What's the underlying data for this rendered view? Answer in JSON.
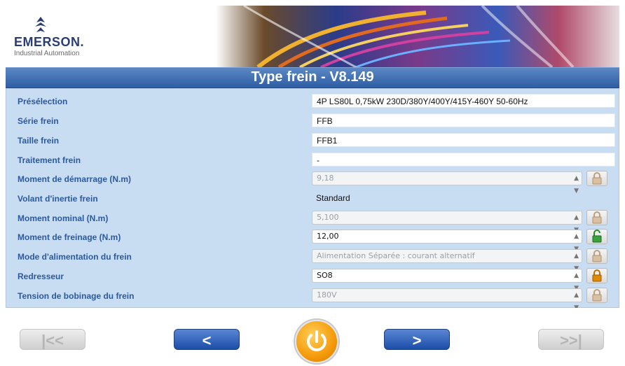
{
  "app": {
    "brand_name": "EMERSON.",
    "brand_sub": "Industrial Automation",
    "title": "Type frein - V8.149"
  },
  "rows": [
    {
      "label": "Présélection",
      "value": "4P LS80L 0,75kW 230D/380Y/400Y/415Y-460Y 50-60Hz",
      "kind": "text"
    },
    {
      "label": "Série frein",
      "value": "FFB",
      "kind": "text"
    },
    {
      "label": "Taille frein",
      "value": "FFB1",
      "kind": "text"
    },
    {
      "label": "Traitement frein",
      "value": "-",
      "kind": "text"
    },
    {
      "label": "Moment de démarrage (N.m)",
      "value": "9,18",
      "kind": "select",
      "state": "disabled",
      "lock": "locked-grey"
    },
    {
      "label": "Volant d'inertie frein",
      "value": "Standard",
      "kind": "plain"
    },
    {
      "label": "Moment nominal (N.m)",
      "value": "5,100",
      "kind": "select",
      "state": "disabled",
      "lock": "locked-grey"
    },
    {
      "label": "Moment de freinage (N.m)",
      "value": "12,00",
      "kind": "select",
      "state": "active",
      "lock": "unlocked-green"
    },
    {
      "label": "Mode d'alimentation du frein",
      "value": "Alimentation Séparée : courant alternatif",
      "kind": "select",
      "state": "disabled",
      "lock": "locked-grey"
    },
    {
      "label": "Redresseur",
      "value": "SO8",
      "kind": "select",
      "state": "active",
      "lock": "locked-orange"
    },
    {
      "label": "Tension de bobinage du frein",
      "value": "180V",
      "kind": "select",
      "state": "disabled",
      "lock": "locked-grey"
    }
  ],
  "nav": {
    "first_glyph": "|<<",
    "prev_glyph": "<",
    "next_glyph": ">",
    "last_glyph": ">>|",
    "power_icon": "power-icon"
  },
  "colors": {
    "title_bar": "#3b6fb6",
    "panel": "#c8dcf2",
    "label": "#2b5aa0",
    "lock_green": "#3aa23a",
    "lock_orange": "#e08a00"
  }
}
